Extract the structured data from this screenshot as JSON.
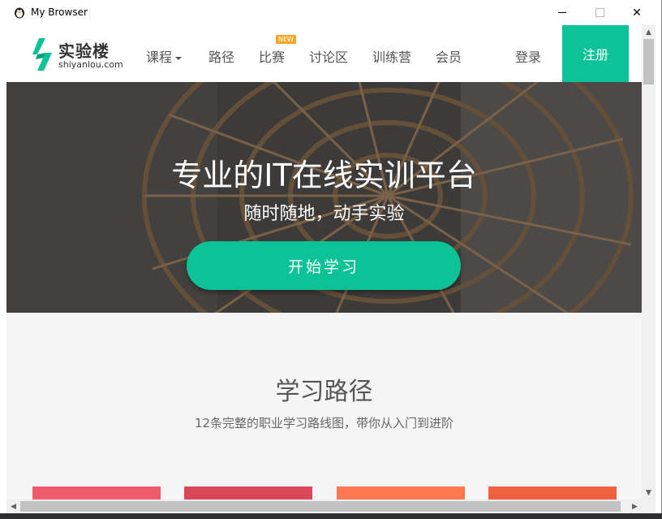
{
  "window": {
    "title": "My Browser",
    "icons": {
      "app": "penguin-icon",
      "minimize": "minimize-icon",
      "maximize": "maximize-icon",
      "close": "close-icon"
    },
    "close_glyph": "✕"
  },
  "navbar": {
    "logo_cn": "实验楼",
    "logo_en": "shiyanlou.com",
    "items": [
      {
        "label": "课程"
      },
      {
        "label": "路径"
      },
      {
        "label": "比赛",
        "badge": "NEW"
      },
      {
        "label": "讨论区"
      },
      {
        "label": "训练营"
      },
      {
        "label": "会员"
      }
    ],
    "login": "登录",
    "register": "注册"
  },
  "hero": {
    "title": "专业的IT在线实训平台",
    "subtitle": "随时随地，动手实验",
    "button": "开始学习"
  },
  "section": {
    "title": "学习路径",
    "subtitle": "12条完整的职业学习路线图，带你从入门到进阶"
  },
  "colors": {
    "brand": "#0cc296",
    "cards": [
      "#ef5b6b",
      "#dc4757",
      "#ff7750",
      "#f05f3e"
    ]
  },
  "scrollbar": {
    "up": "▲",
    "down": "▼",
    "left": "◀",
    "right": "▶"
  }
}
